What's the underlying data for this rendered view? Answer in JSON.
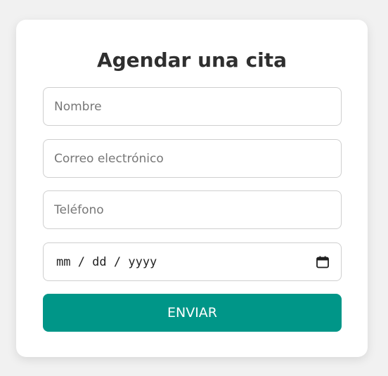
{
  "form": {
    "title": "Agendar una cita",
    "name_placeholder": "Nombre",
    "email_placeholder": "Correo electrónico",
    "phone_placeholder": "Teléfono",
    "date_placeholder": "mm / dd / yyyy",
    "date_icon": "calendar-icon",
    "submit_label": "ENVIAR"
  },
  "colors": {
    "accent": "#009688",
    "background": "#f1f1f1",
    "card": "#ffffff",
    "border": "#cfcfcf"
  }
}
